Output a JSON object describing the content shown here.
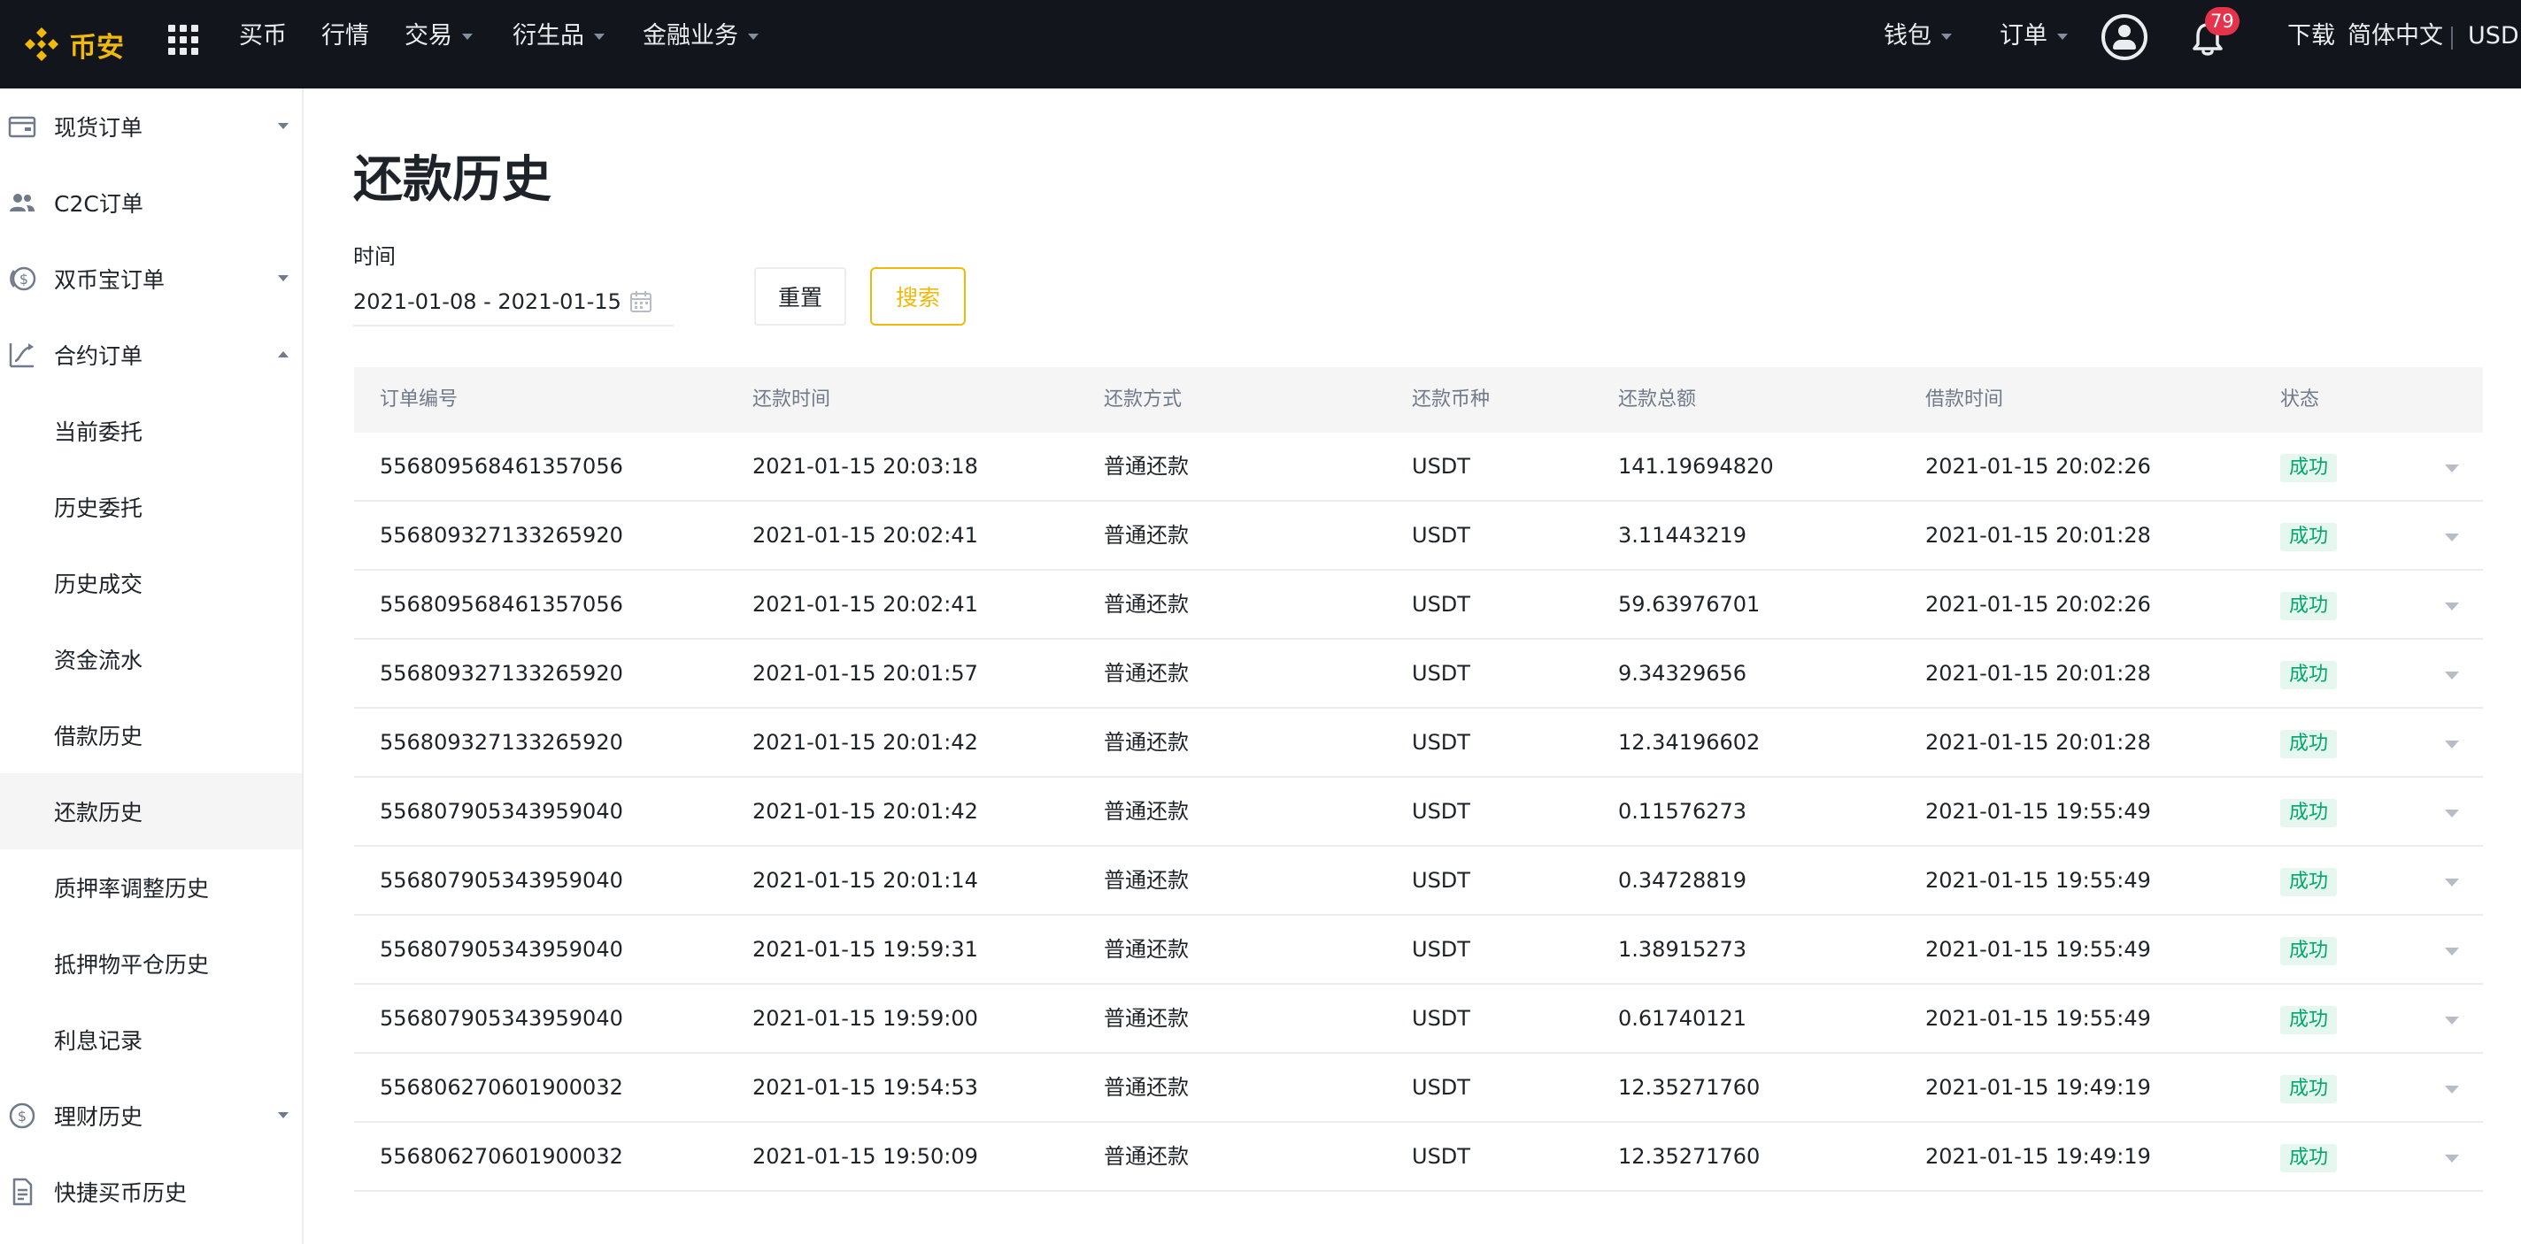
{
  "header": {
    "logo_text": "币安",
    "brand_color": "#F0B90B",
    "nav": [
      {
        "label": "买币",
        "has_caret": false
      },
      {
        "label": "行情",
        "has_caret": false
      },
      {
        "label": "交易",
        "has_caret": true
      },
      {
        "label": "衍生品",
        "has_caret": true
      },
      {
        "label": "金融业务",
        "has_caret": true
      }
    ],
    "right": {
      "wallet_label": "钱包",
      "orders_label": "订单",
      "notification_count": "79",
      "download_label": "下载",
      "language_label": "简体中文",
      "currency_label": "USD"
    },
    "icons": [
      "binance-logo-icon",
      "apps-grid-icon",
      "user-account-icon",
      "bell-icon"
    ]
  },
  "sidebar": {
    "items": [
      {
        "label": "现货订单",
        "icon": "wallet-icon",
        "caret": "down"
      },
      {
        "label": "C2C订单",
        "icon": "users-icon",
        "caret": ""
      },
      {
        "label": "双币宝订单",
        "icon": "dual-coin-icon",
        "caret": "down"
      },
      {
        "label": "合约订单",
        "icon": "futures-icon",
        "caret": "up"
      },
      {
        "label": "当前委托",
        "icon": "",
        "caret": ""
      },
      {
        "label": "历史委托",
        "icon": "",
        "caret": ""
      },
      {
        "label": "历史成交",
        "icon": "",
        "caret": ""
      },
      {
        "label": "资金流水",
        "icon": "",
        "caret": ""
      },
      {
        "label": "借款历史",
        "icon": "",
        "caret": ""
      },
      {
        "label": "还款历史",
        "icon": "",
        "caret": "",
        "active": true
      },
      {
        "label": "质押率调整历史",
        "icon": "",
        "caret": ""
      },
      {
        "label": "抵押物平仓历史",
        "icon": "",
        "caret": ""
      },
      {
        "label": "利息记录",
        "icon": "",
        "caret": ""
      },
      {
        "label": "理财历史",
        "icon": "earn-icon",
        "caret": "down"
      },
      {
        "label": "快捷买币历史",
        "icon": "document-icon",
        "caret": ""
      }
    ]
  },
  "main": {
    "title": "还款历史",
    "filter": {
      "time_label": "时间",
      "date_range": "2021-01-08 - 2021-01-15",
      "reset_label": "重置",
      "search_label": "搜索"
    },
    "table": {
      "columns": [
        "订单编号",
        "还款时间",
        "还款方式",
        "还款币种",
        "还款总额",
        "借款时间",
        "状态"
      ],
      "rows": [
        {
          "order_id": "556809568461357056",
          "repay_time": "2021-01-15 20:03:18",
          "method": "普通还款",
          "coin": "USDT",
          "amount": "141.19694820",
          "borrow_time": "2021-01-15 20:02:26",
          "status": "成功"
        },
        {
          "order_id": "556809327133265920",
          "repay_time": "2021-01-15 20:02:41",
          "method": "普通还款",
          "coin": "USDT",
          "amount": "3.11443219",
          "borrow_time": "2021-01-15 20:01:28",
          "status": "成功"
        },
        {
          "order_id": "556809568461357056",
          "repay_time": "2021-01-15 20:02:41",
          "method": "普通还款",
          "coin": "USDT",
          "amount": "59.63976701",
          "borrow_time": "2021-01-15 20:02:26",
          "status": "成功"
        },
        {
          "order_id": "556809327133265920",
          "repay_time": "2021-01-15 20:01:57",
          "method": "普通还款",
          "coin": "USDT",
          "amount": "9.34329656",
          "borrow_time": "2021-01-15 20:01:28",
          "status": "成功"
        },
        {
          "order_id": "556809327133265920",
          "repay_time": "2021-01-15 20:01:42",
          "method": "普通还款",
          "coin": "USDT",
          "amount": "12.34196602",
          "borrow_time": "2021-01-15 20:01:28",
          "status": "成功"
        },
        {
          "order_id": "556807905343959040",
          "repay_time": "2021-01-15 20:01:42",
          "method": "普通还款",
          "coin": "USDT",
          "amount": "0.11576273",
          "borrow_time": "2021-01-15 19:55:49",
          "status": "成功"
        },
        {
          "order_id": "556807905343959040",
          "repay_time": "2021-01-15 20:01:14",
          "method": "普通还款",
          "coin": "USDT",
          "amount": "0.34728819",
          "borrow_time": "2021-01-15 19:55:49",
          "status": "成功"
        },
        {
          "order_id": "556807905343959040",
          "repay_time": "2021-01-15 19:59:31",
          "method": "普通还款",
          "coin": "USDT",
          "amount": "1.38915273",
          "borrow_time": "2021-01-15 19:55:49",
          "status": "成功"
        },
        {
          "order_id": "556807905343959040",
          "repay_time": "2021-01-15 19:59:00",
          "method": "普通还款",
          "coin": "USDT",
          "amount": "0.61740121",
          "borrow_time": "2021-01-15 19:55:49",
          "status": "成功"
        },
        {
          "order_id": "556806270601900032",
          "repay_time": "2021-01-15 19:54:53",
          "method": "普通还款",
          "coin": "USDT",
          "amount": "12.35271760",
          "borrow_time": "2021-01-15 19:49:19",
          "status": "成功"
        },
        {
          "order_id": "556806270601900032",
          "repay_time": "2021-01-15 19:50:09",
          "method": "普通还款",
          "coin": "USDT",
          "amount": "12.35271760",
          "borrow_time": "2021-01-15 19:49:19",
          "status": "成功"
        }
      ]
    },
    "status_color": "#03A66D"
  }
}
